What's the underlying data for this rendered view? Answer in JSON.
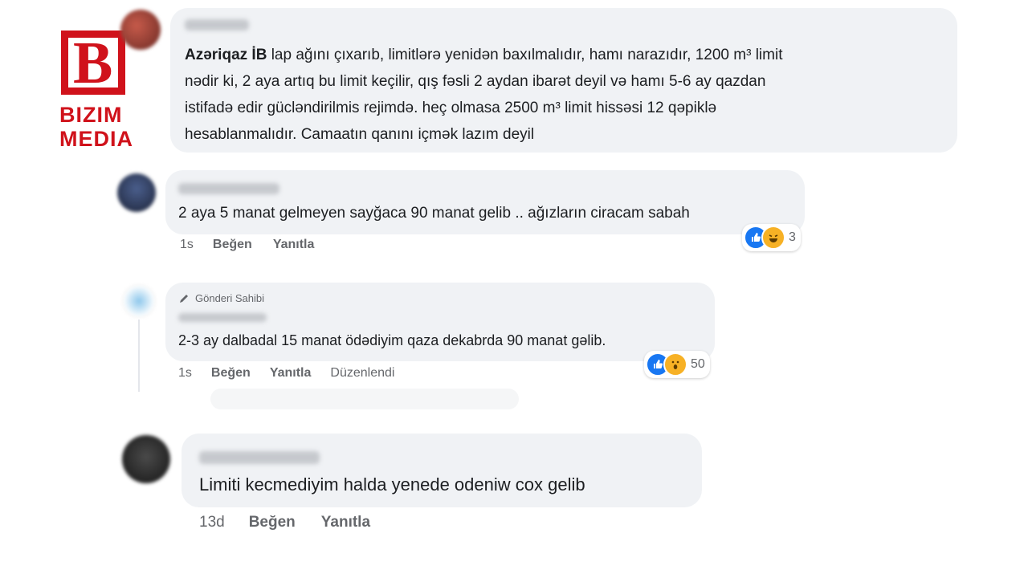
{
  "logo": {
    "line1": "BIZIM",
    "line2": "MEDIA",
    "mark": "B",
    "color": "#d0121b"
  },
  "comments": [
    {
      "body_bold": "Azəriqaz İB",
      "body_lines": [
        " lap ağını çıxarıb, limitlərə yenidən baxılmalıdır, hamı narazıdır, 1200 m³ limit",
        "nədir ki, 2 aya artıq bu limit keçilir, qış fəsli 2 aydan ibarət deyil və hamı 5-6 ay qazdan",
        "istifadə edir gücləndirilmis rejimdə. heç olmasa 2500 m³ limit hissəsi 12 qəpiklə",
        "hesablanmalıdır. Camaatın qanını içmək lazım deyil"
      ]
    },
    {
      "body": "2 aya 5 manat gelmeyen sayğaca 90 manat gelib .. ağızların ciracam sabah",
      "time": "1s",
      "like_label": "Beğen",
      "reply_label": "Yanıtla",
      "reaction_count": "3",
      "reactions": [
        "like-icon",
        "haha-icon"
      ]
    },
    {
      "badge": "Gönderi Sahibi",
      "body": "2-3 ay dalbadal 15 manat ödədiyim qaza dekabrda 90 manat gəlib.",
      "time": "1s",
      "like_label": "Beğen",
      "reply_label": "Yanıtla",
      "edited_label": "Düzenlendi",
      "reaction_count": "50",
      "reactions": [
        "like-icon",
        "wow-icon"
      ]
    },
    {
      "body": "Limiti kecmediyim halda yenede odeniw cox gelib",
      "time": "13d",
      "like_label": "Beğen",
      "reply_label": "Yanıtla"
    }
  ],
  "colors": {
    "bubble": "#f0f2f5",
    "like": "#1877f2",
    "emoji": "#f7b125"
  }
}
